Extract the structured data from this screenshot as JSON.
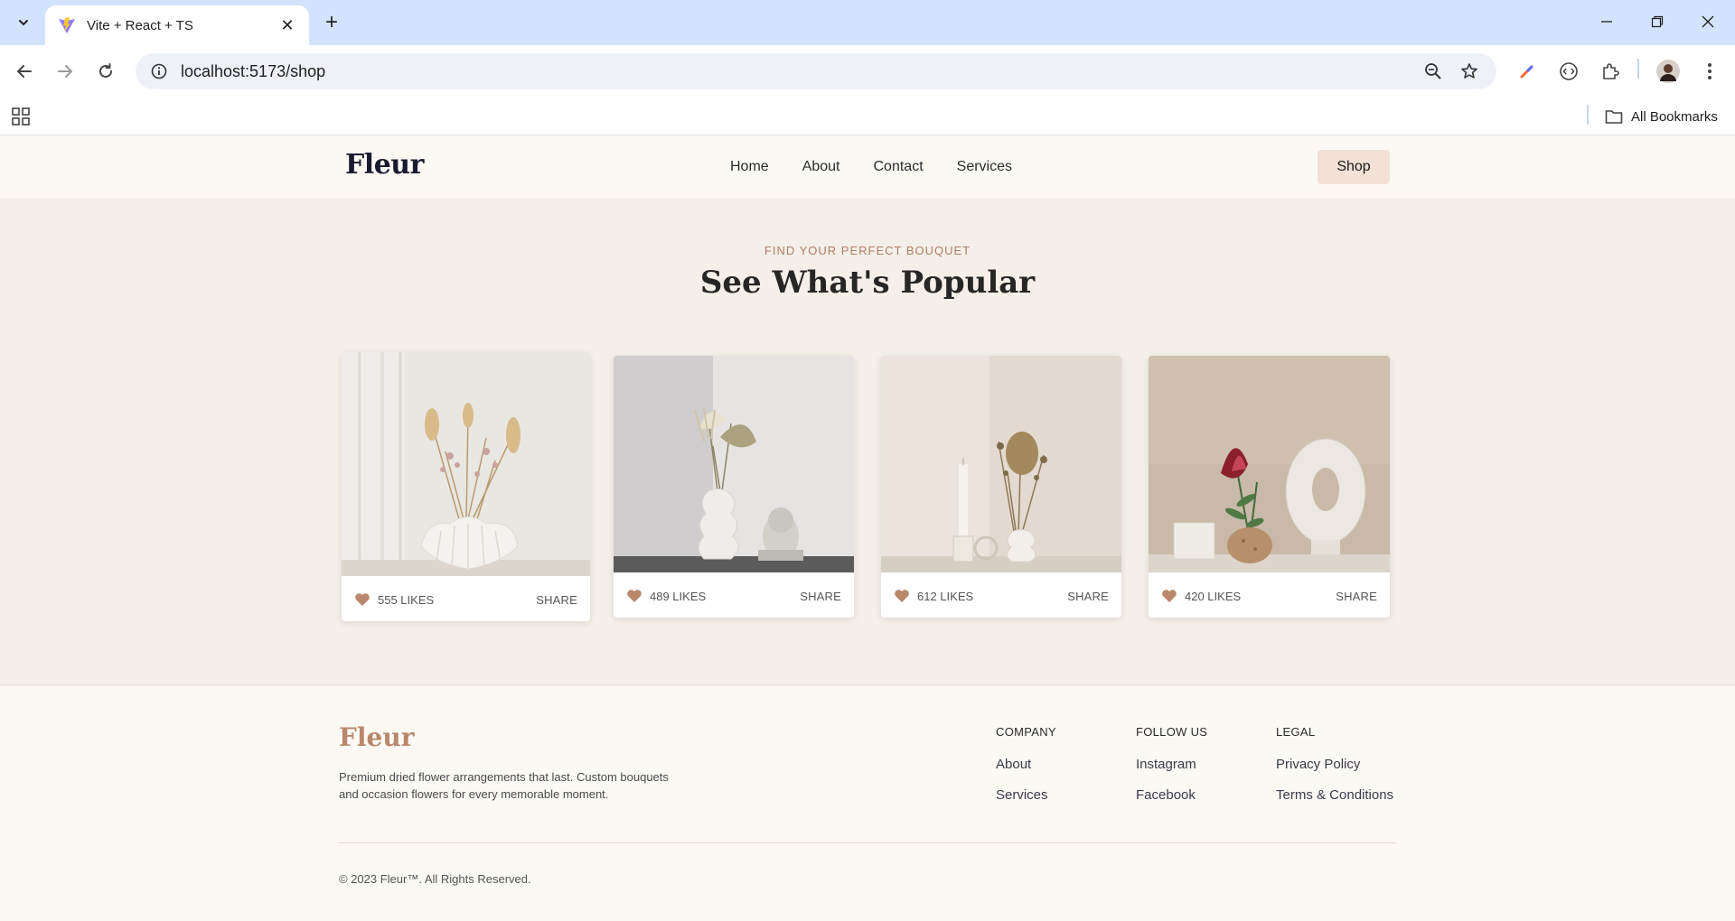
{
  "browser": {
    "tab_title": "Vite + React + TS",
    "url": "localhost:5173/shop",
    "bookmarks_label": "All Bookmarks"
  },
  "site": {
    "logo": "Fleur",
    "nav": [
      "Home",
      "About",
      "Contact",
      "Services"
    ],
    "shop_label": "Shop"
  },
  "popular": {
    "eyebrow": "FIND YOUR PERFECT BOUQUET",
    "title": "See What's Popular",
    "cards": [
      {
        "likes": "555 LIKES",
        "share": "SHARE"
      },
      {
        "likes": "489 LIKES",
        "share": "SHARE"
      },
      {
        "likes": "612 LIKES",
        "share": "SHARE"
      },
      {
        "likes": "420 LIKES",
        "share": "SHARE"
      }
    ]
  },
  "footer": {
    "logo": "Fleur",
    "description": "Premium dried flower arrangements that last. Custom bouquets and occasion flowers for every memorable moment.",
    "columns": [
      {
        "heading": "COMPANY",
        "links": [
          "About",
          "Services"
        ]
      },
      {
        "heading": "FOLLOW US",
        "links": [
          "Instagram",
          "Facebook"
        ]
      },
      {
        "heading": "LEGAL",
        "links": [
          "Privacy Policy",
          "Terms & Conditions"
        ]
      }
    ],
    "copyright": "© 2023 Fleur™. All Rights Reserved."
  },
  "colors": {
    "accent": "#b07e66",
    "heart": "#b9876b",
    "page_bg": "#f4efe9",
    "header_bg": "#fcf9f5",
    "shop_button_bg": "#f1e1d6"
  }
}
